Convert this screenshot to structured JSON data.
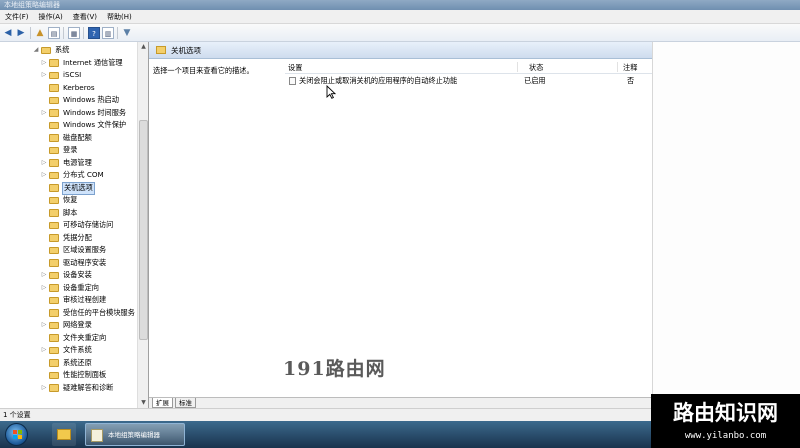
{
  "window": {
    "title": "本地组策略编辑器"
  },
  "menu": [
    "文件(F)",
    "操作(A)",
    "查看(V)",
    "帮助(H)"
  ],
  "toolbar": {
    "icons": [
      "back-icon",
      "forward-icon",
      "up-folder-icon",
      "show-hide-tree-icon",
      "export-list-icon",
      "help-icon",
      "properties-icon",
      "filter-icon"
    ]
  },
  "tree": {
    "root": {
      "label": "系统"
    },
    "items": [
      {
        "label": "Internet 通信管理",
        "expandable": true
      },
      {
        "label": "iSCSI",
        "expandable": true
      },
      {
        "label": "Kerberos",
        "expandable": false
      },
      {
        "label": "Windows 热启动",
        "expandable": false
      },
      {
        "label": "Windows 时间服务",
        "expandable": true
      },
      {
        "label": "Windows 文件保护",
        "expandable": false
      },
      {
        "label": "磁盘配额",
        "expandable": false
      },
      {
        "label": "登录",
        "expandable": false
      },
      {
        "label": "电源管理",
        "expandable": true
      },
      {
        "label": "分布式 COM",
        "expandable": true
      },
      {
        "label": "关机选项",
        "expandable": false,
        "selected": true
      },
      {
        "label": "恢复",
        "expandable": false
      },
      {
        "label": "脚本",
        "expandable": false
      },
      {
        "label": "可移动存储访问",
        "expandable": false
      },
      {
        "label": "凭据分配",
        "expandable": false
      },
      {
        "label": "区域设置服务",
        "expandable": false
      },
      {
        "label": "驱动程序安装",
        "expandable": false
      },
      {
        "label": "设备安装",
        "expandable": true
      },
      {
        "label": "设备重定向",
        "expandable": true
      },
      {
        "label": "审核过程创建",
        "expandable": false
      },
      {
        "label": "受信任的平台模块服务",
        "expandable": false
      },
      {
        "label": "网络登录",
        "expandable": true
      },
      {
        "label": "文件夹重定向",
        "expandable": false
      },
      {
        "label": "文件系统",
        "expandable": true
      },
      {
        "label": "系统还原",
        "expandable": false
      },
      {
        "label": "性能控制面板",
        "expandable": false
      },
      {
        "label": "疑难解答和诊断",
        "expandable": true
      }
    ]
  },
  "details": {
    "header": "关机选项",
    "description": "选择一个项目来查看它的描述。",
    "columns": {
      "setting": "设置",
      "state": "状态",
      "comment": "注释"
    },
    "rows": [
      {
        "setting": "关闭会阻止或取消关机的应用程序的自动终止功能",
        "state": "已启用",
        "comment": "否"
      }
    ],
    "tabs": [
      "扩展",
      "标准"
    ]
  },
  "status": {
    "text": "1 个设置"
  },
  "taskbar": {
    "app_label": "本地组策略编辑器"
  },
  "watermarks": {
    "center": "191路由网",
    "corner": "路由知识网",
    "corner_url": "www.yilanbo.com"
  }
}
